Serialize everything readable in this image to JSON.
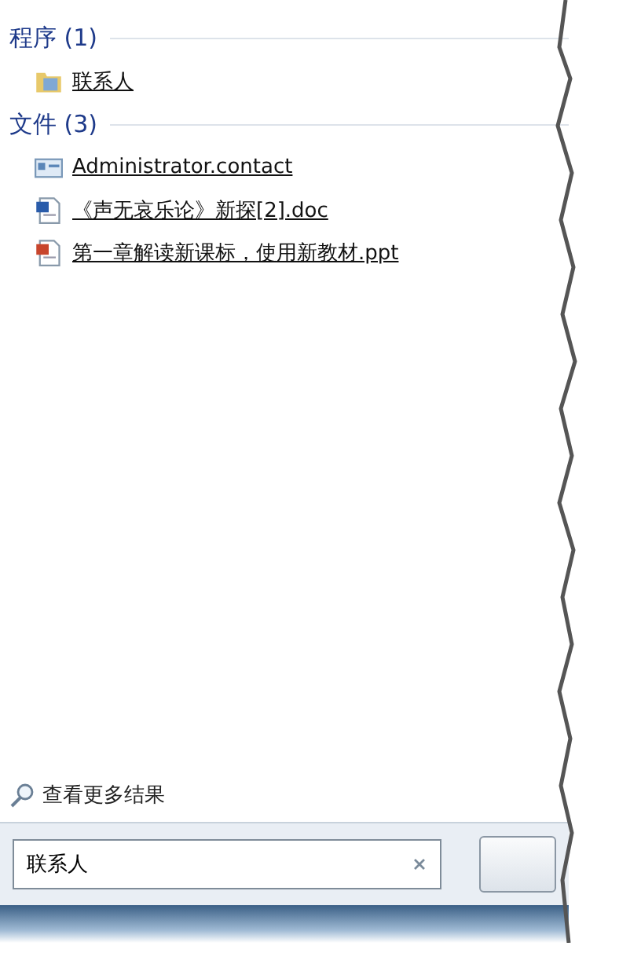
{
  "groups": [
    {
      "title": "程序 (1)",
      "items": [
        {
          "kind": "folder",
          "label": "联系人"
        }
      ]
    },
    {
      "title": "文件 (3)",
      "items": [
        {
          "kind": "contact",
          "label": "Administrator.contact"
        },
        {
          "kind": "word",
          "label": "《声无哀乐论》新探[2].doc"
        },
        {
          "kind": "ppt",
          "label": "第一章解读新课标，使用新教材.ppt"
        }
      ]
    }
  ],
  "more_results": "查看更多结果",
  "search": {
    "value": "联系人"
  }
}
